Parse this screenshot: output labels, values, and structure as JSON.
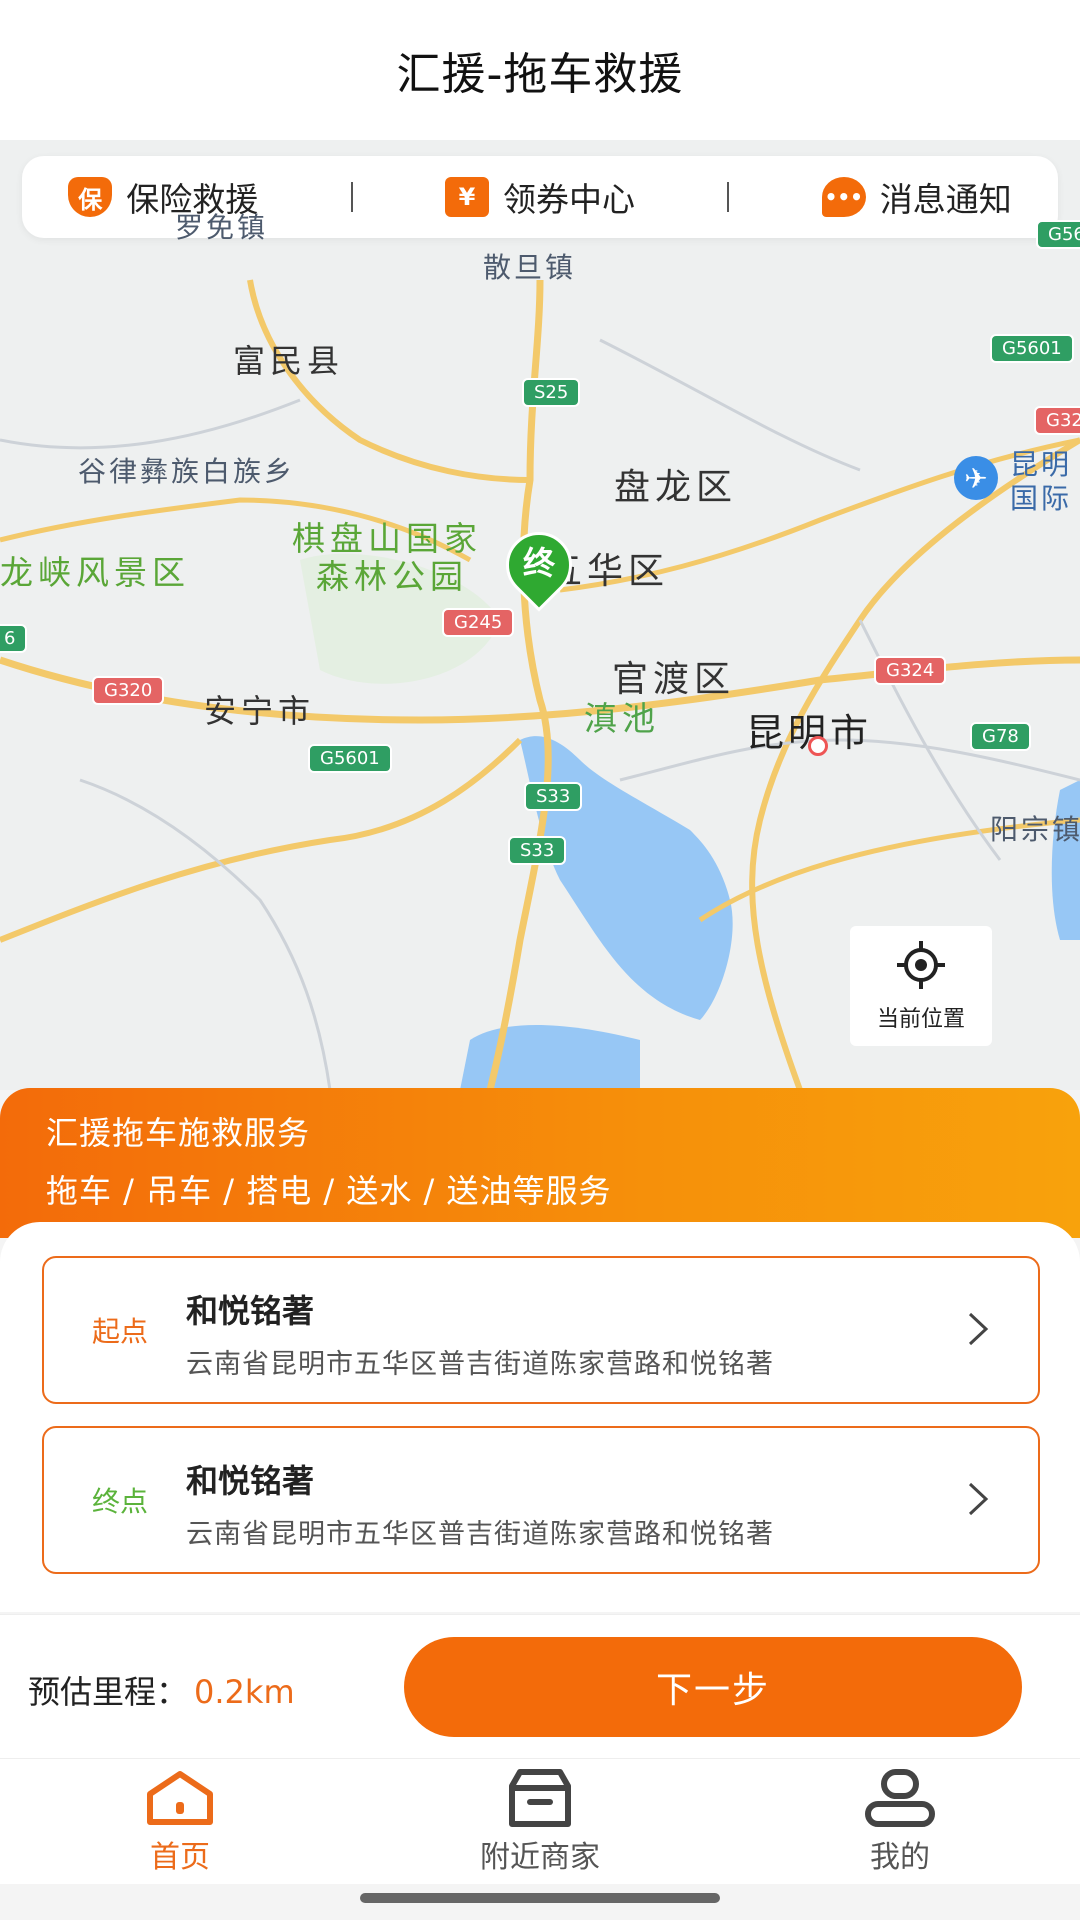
{
  "header": {
    "title": "汇援-拖车救援"
  },
  "top_tabs": [
    {
      "label": "保险救援",
      "icon": "shield-icon",
      "icon_text": "保"
    },
    {
      "label": "领券中心",
      "icon": "ticket-icon",
      "icon_text": "¥"
    },
    {
      "label": "消息通知",
      "icon": "chat-bubble-icon",
      "icon_text": "•••"
    }
  ],
  "map": {
    "labels": {
      "luomian": "罗免镇",
      "sandan": "散旦镇",
      "fumin": "富民县",
      "gulv": "谷律彝族白族乡",
      "panlong": "盘龙区",
      "kunming_airport": "昆明国际",
      "qipan_1": "棋盘山国家",
      "qipan_2": "森林公园",
      "longxia": "龙峡风景区",
      "wuhua": "五华区",
      "guandu": "官渡区",
      "anning": "安宁市",
      "dianchi": "滇池",
      "kunming": "昆明市",
      "yangzong": "阳宗镇"
    },
    "road_signs": {
      "s25": "S25",
      "g5601_top": "G5601",
      "g56_top": "G56",
      "g32": "G32",
      "g245": "G245",
      "g320": "G320",
      "g324": "G324",
      "g5601_bottom": "G5601",
      "g78": "G78",
      "s33_a": "S33",
      "s33_b": "S33",
      "g6": "6"
    },
    "pin_text": "终",
    "locate_label": "当前位置",
    "accent": "#f36b0a"
  },
  "service": {
    "line1": "汇援拖车施救服务",
    "line2": "拖车 / 吊车 / 搭电 / 送水 / 送油等服务"
  },
  "start": {
    "tag": "起点",
    "name": "和悦铭著",
    "address": "云南省昆明市五华区普吉街道陈家营路和悦铭著"
  },
  "end": {
    "tag": "终点",
    "name": "和悦铭著",
    "address": "云南省昆明市五华区普吉街道陈家营路和悦铭著"
  },
  "estimate": {
    "label": "预估里程：",
    "value": "0.2km"
  },
  "next_button": "下一步",
  "nav": [
    {
      "label": "首页",
      "icon": "home-icon",
      "active": true
    },
    {
      "label": "附近商家",
      "icon": "store-box-icon",
      "active": false
    },
    {
      "label": "我的",
      "icon": "user-icon",
      "active": false
    }
  ]
}
